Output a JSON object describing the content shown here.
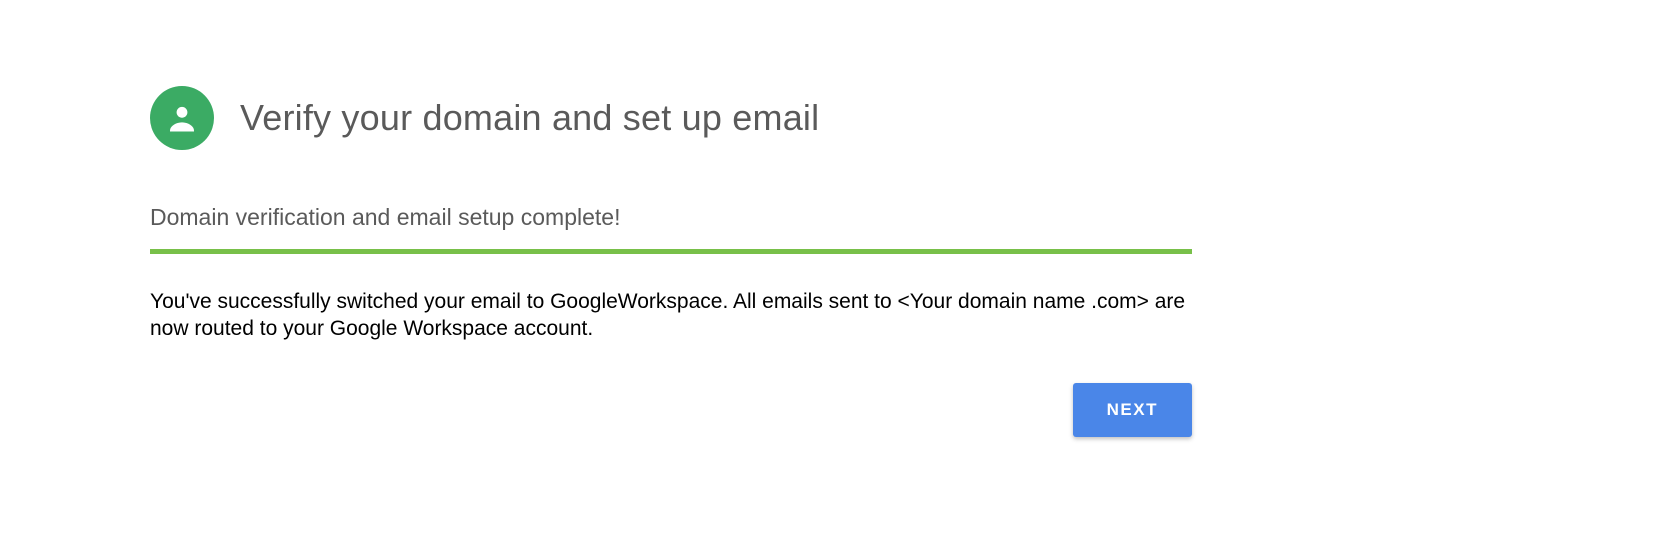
{
  "header": {
    "title": "Verify your domain and set up email"
  },
  "status": {
    "text": "Domain verification and email setup complete!"
  },
  "description": "You've successfully switched your email to GoogleWorkspace. All emails sent to <Your domain name .com> are now routed to your Google Workspace account.",
  "button": {
    "next_label": "NEXT"
  }
}
